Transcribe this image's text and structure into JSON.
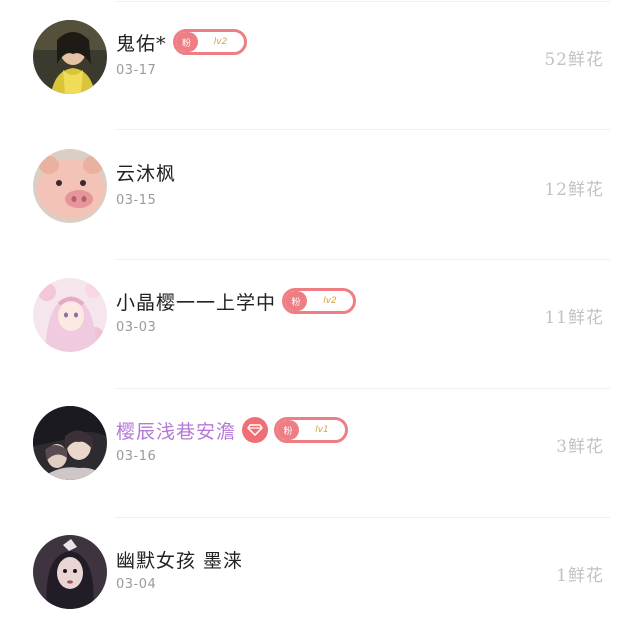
{
  "gift_list": {
    "rows": [
      {
        "name": "鬼佑*",
        "date": "03-17",
        "flowers": "52鲜花",
        "fan_badge": {
          "tag": "粉",
          "level": "lv2"
        },
        "avatar": "avatar-girl-yellow-dress"
      },
      {
        "name": "云沐枫",
        "date": "03-15",
        "flowers": "12鲜花",
        "avatar": "avatar-pig"
      },
      {
        "name": "小晶樱一一上学中",
        "date": "03-03",
        "flowers": "11鲜花",
        "fan_badge": {
          "tag": "粉",
          "level": "lv2"
        },
        "avatar": "avatar-pink-anime"
      },
      {
        "name": "樱辰浅巷安澹",
        "date": "03-16",
        "flowers": "3鲜花",
        "vip": true,
        "fan_badge": {
          "tag": "粉",
          "level": "lv1"
        },
        "avatar": "avatar-anime-couple"
      },
      {
        "name": "幽默女孩 墨涞",
        "date": "03-04",
        "flowers": "1鲜花",
        "avatar": "avatar-dark-hair-girl"
      }
    ]
  },
  "colors": {
    "badge_accent": "#ef7e84",
    "vip_name": "#b57ad8",
    "level_text": "#d9a33a",
    "meta_text": "#9a9a9a",
    "flowers_text": "#c2c2c2"
  }
}
